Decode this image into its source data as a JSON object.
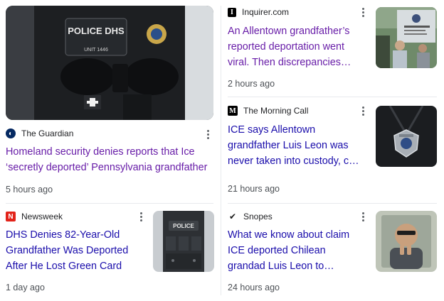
{
  "articles": [
    {
      "source": "The Guardian",
      "favicon_glyph": "◐",
      "favicon_color": "#052962",
      "headline": "Homeland security denies reports that Ice ‘secretly deported’ Pennsylvania grandfather",
      "time": "5 hours ago",
      "visited": true,
      "image_label": "POLICE DHS",
      "image_sublabel": "UNIT 1446"
    },
    {
      "source": "Inquirer.com",
      "favicon_glyph": "I",
      "favicon_color": "#000000",
      "headline": "An Allentown grandfather’s reported deportation went viral. Then discrepancies…",
      "time": "2 hours ago",
      "visited": true
    },
    {
      "source": "The Morning Call",
      "favicon_glyph": "M",
      "favicon_color": "#000000",
      "headline": "ICE says Allentown grandfather Luis Leon was never taken into custody, c…",
      "time": "21 hours ago",
      "visited": false
    },
    {
      "source": "Newsweek",
      "favicon_glyph": "N",
      "favicon_color": "#e2231a",
      "headline": "DHS Denies 82-Year-Old Grandfather Was Deported After He Lost Green Card",
      "time": "1 day ago",
      "visited": false,
      "image_label": "POLICE"
    },
    {
      "source": "Snopes",
      "favicon_glyph": "✔",
      "favicon_color": "#f5c400",
      "headline": "What we know about claim ICE deported Chilean grandad Luis Leon to…",
      "time": "24 hours ago",
      "visited": false
    }
  ],
  "colors": {
    "link": "#1a0dab",
    "visited": "#681da8",
    "meta": "#4d5156",
    "divider": "#e8eaed"
  }
}
